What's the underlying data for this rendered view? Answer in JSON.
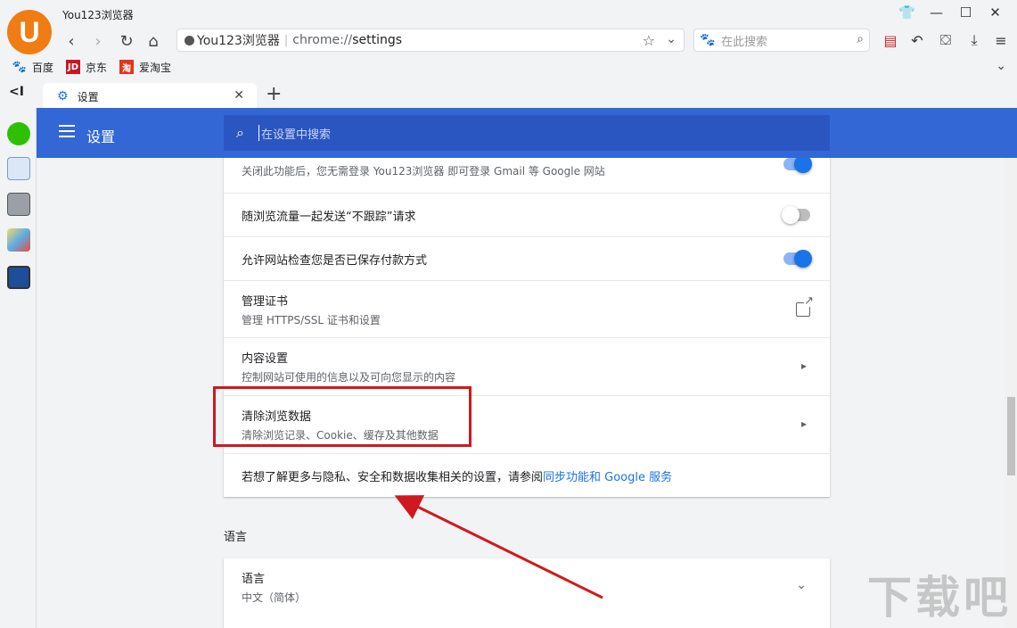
{
  "app": {
    "logo_letter": "U",
    "title": "You123浏览器"
  },
  "address": {
    "site_name": "You123浏览器",
    "scheme": "chrome://",
    "path": "settings"
  },
  "search": {
    "placeholder": "在此搜索"
  },
  "bookmarks": [
    {
      "label": "百度",
      "icon": "baidu-paw-icon"
    },
    {
      "label": "京东",
      "icon": "jd-icon",
      "badge": "JD"
    },
    {
      "label": "爱淘宝",
      "icon": "taobao-icon",
      "badge": "淘"
    }
  ],
  "tab": {
    "label": "设置"
  },
  "header": {
    "title": "设置",
    "search_placeholder": "在设置中搜索"
  },
  "privacy": {
    "row0_sub": "关闭此功能后，您无需登录 You123浏览器 即可登录 Gmail 等 Google 网站",
    "row1_title": "随浏览流量一起发送“不跟踪”请求",
    "row2_title": "允许网站检查您是否已保存付款方式",
    "row3_title": "管理证书",
    "row3_sub": "管理 HTTPS/SSL 证书和设置",
    "row4_title": "内容设置",
    "row4_sub": "控制网站可使用的信息以及可向您显示的内容",
    "row5_title": "清除浏览数据",
    "row5_sub": "清除浏览记录、Cookie、缓存及其他数据",
    "footer_text": "若想了解更多与隐私、安全和数据收集相关的设置，请参阅",
    "footer_link": "同步功能和 Google 服务",
    "toggles": {
      "row0": true,
      "row1": false,
      "row2": true
    }
  },
  "language": {
    "section_title": "语言",
    "row_title": "语言",
    "row_sub": "中文（简体）"
  },
  "colors": {
    "header": "#3367d6",
    "accent": "#1a73e8",
    "annotation": "#d0191e"
  },
  "watermark": "下载吧"
}
